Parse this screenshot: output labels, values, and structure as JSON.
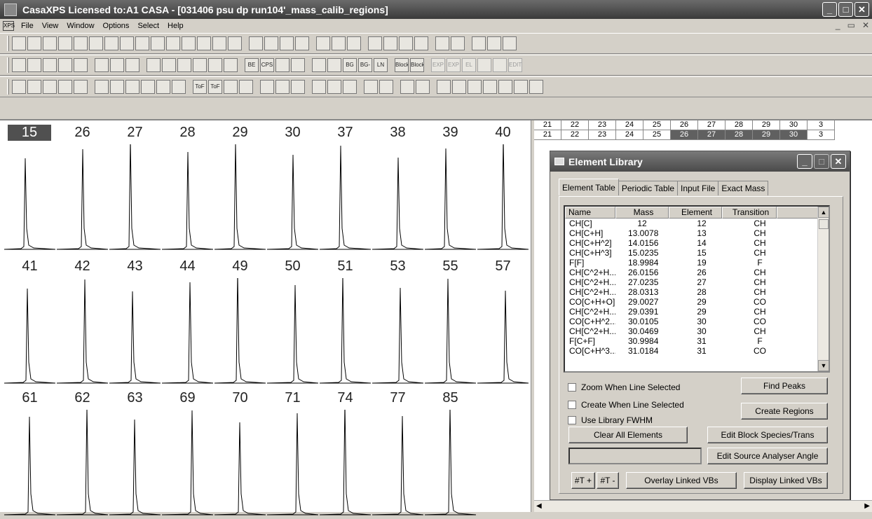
{
  "window": {
    "title": "CasaXPS Licensed to:A1 CASA - [031406 psu dp run104'_mass_calib_regions]",
    "controls": [
      "_",
      "□",
      "✕"
    ]
  },
  "menu": {
    "items": [
      "File",
      "View",
      "Window",
      "Options",
      "Select",
      "Help"
    ],
    "mdi_controls": [
      "_",
      "▭",
      "✕"
    ]
  },
  "toolbar1": [
    "new",
    "open",
    "open2",
    "save",
    "copy",
    "paste",
    "paste2",
    "paste3",
    "print-prev",
    "a",
    "b",
    "c",
    "d",
    "e",
    "f",
    "g",
    "h",
    "win1",
    "win2",
    "win3",
    "arrows",
    "pen",
    "grid",
    "tool1",
    "tool2",
    "tool3",
    "lock",
    "brush",
    "printer",
    "preview",
    "help"
  ],
  "toolbar2": {
    "labels": [
      "BE KE",
      "CPS C",
      "",
      "",
      "",
      "",
      "BG",
      "BG- SUB",
      "LN",
      "Block Com",
      "Block Info",
      "EXP VBr",
      "EXP VBr",
      "EL TR",
      "",
      "",
      "EDIT MODE"
    ]
  },
  "toolbar3": {
    "labels": [
      "ToF calib",
      "ToF calib"
    ]
  },
  "spectra": {
    "selected": "15",
    "rows": [
      [
        "15",
        "26",
        "27",
        "28",
        "29",
        "30",
        "37",
        "38",
        "39",
        "40"
      ],
      [
        "41",
        "42",
        "43",
        "44",
        "49",
        "50",
        "51",
        "53",
        "55",
        "57"
      ],
      [
        "61",
        "62",
        "63",
        "69",
        "70",
        "71",
        "74",
        "77",
        "85",
        ""
      ]
    ]
  },
  "grid_header": {
    "row1": [
      "21",
      "22",
      "23",
      "24",
      "25",
      "26",
      "27",
      "28",
      "29",
      "30",
      "3"
    ],
    "row2": [
      "21",
      "22",
      "23",
      "24",
      "25",
      "26",
      "27",
      "28",
      "29",
      "30",
      "3"
    ],
    "highlighted_row2": [
      "26",
      "27",
      "28",
      "29",
      "30"
    ]
  },
  "dialog": {
    "title": "Element Library",
    "tabs": [
      "Element Table",
      "Periodic Table",
      "Input File",
      "Exact Mass"
    ],
    "active_tab": "Element Table",
    "columns": [
      "Name",
      "Mass",
      "Element",
      "Transition"
    ],
    "rows": [
      [
        "CH[C]",
        "12",
        "12",
        "CH"
      ],
      [
        "CH[C+H]",
        "13.0078",
        "13",
        "CH"
      ],
      [
        "CH[C+H^2]",
        "14.0156",
        "14",
        "CH"
      ],
      [
        "CH[C+H^3]",
        "15.0235",
        "15",
        "CH"
      ],
      [
        "F[F]",
        "18.9984",
        "19",
        "F"
      ],
      [
        "CH[C^2+H...",
        "26.0156",
        "26",
        "CH"
      ],
      [
        "CH[C^2+H...",
        "27.0235",
        "27",
        "CH"
      ],
      [
        "CH[C^2+H...",
        "28.0313",
        "28",
        "CH"
      ],
      [
        "CO[C+H+O]",
        "29.0027",
        "29",
        "CO"
      ],
      [
        "CH[C^2+H...",
        "29.0391",
        "29",
        "CH"
      ],
      [
        "CO[C+H^2...",
        "30.0105",
        "30",
        "CO"
      ],
      [
        "CH[C^2+H...",
        "30.0469",
        "30",
        "CH"
      ],
      [
        "F[C+F]",
        "30.9984",
        "31",
        "F"
      ],
      [
        "CO[C+H^3...",
        "31.0184",
        "31",
        "CO"
      ]
    ],
    "checkboxes": [
      "Zoom When Line Selected",
      "Create When Line Selected",
      "Use Library FWHM"
    ],
    "buttons": {
      "find_peaks": "Find Peaks",
      "create_regions": "Create Regions",
      "clear_all": "Clear All Elements",
      "edit_block": "Edit Block Species/Trans",
      "edit_source": "Edit Source Analyser Angle",
      "t_plus": "#T +",
      "t_minus": "#T -",
      "overlay": "Overlay Linked VBs",
      "display": "Display Linked VBs"
    }
  }
}
